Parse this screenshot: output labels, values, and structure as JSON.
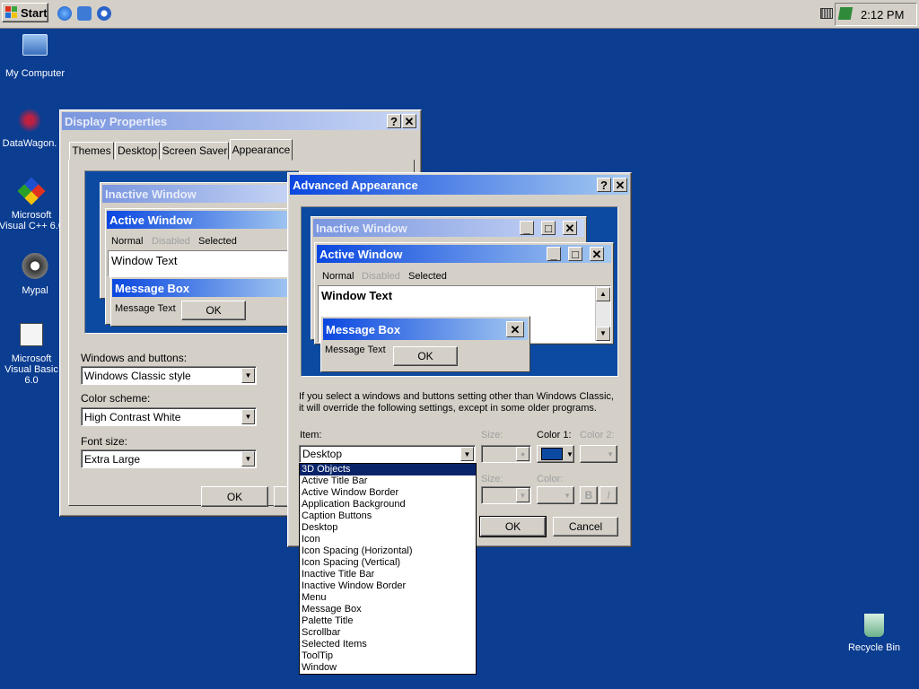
{
  "taskbar": {
    "start_label": "Start",
    "clock": "2:12 PM"
  },
  "desktop_icons": [
    {
      "label": "My Computer"
    },
    {
      "label": "DataWagon."
    },
    {
      "label": "Microsoft Visual C++ 6.0"
    },
    {
      "label": "Mypal"
    },
    {
      "label": "Microsoft Visual Basic 6.0"
    },
    {
      "label": "Recycle Bin"
    }
  ],
  "display_properties": {
    "title": "Display Properties",
    "tabs": [
      "Themes",
      "Desktop",
      "Screen Saver",
      "Appearance"
    ],
    "preview": {
      "inactive_title": "Inactive Window",
      "active_title": "Active Window",
      "menu_normal": "Normal",
      "menu_disabled": "Disabled",
      "menu_selected": "Selected",
      "window_text": "Window Text",
      "msgbox_title": "Message Box",
      "msgbox_text": "Message Text",
      "ok": "OK"
    },
    "windows_buttons_label": "Windows and buttons:",
    "windows_buttons_value": "Windows Classic style",
    "color_scheme_label": "Color scheme:",
    "color_scheme_value": "High Contrast White",
    "font_size_label": "Font size:",
    "font_size_value": "Extra Large",
    "ok": "OK"
  },
  "advanced": {
    "title": "Advanced Appearance",
    "preview": {
      "inactive_title": "Inactive Window",
      "active_title": "Active Window",
      "menu_normal": "Normal",
      "menu_disabled": "Disabled",
      "menu_selected": "Selected",
      "window_text": "Window Text",
      "msgbox_title": "Message Box",
      "msgbox_text": "Message Text",
      "ok": "OK"
    },
    "info_line1": "If you select a windows and buttons setting other than Windows Classic,",
    "info_line2": "it will override the following settings, except in some older programs.",
    "item_label": "Item:",
    "item_value": "Desktop",
    "size_label": "Size:",
    "color1_label": "Color 1:",
    "color2_label": "Color 2:",
    "font_size_label": "Size:",
    "font_color_label": "Color:",
    "bold": "B",
    "italic": "I",
    "ok": "OK",
    "cancel": "Cancel",
    "color1_hex": "#0b4aa0",
    "items": [
      "3D Objects",
      "Active Title Bar",
      "Active Window Border",
      "Application Background",
      "Caption Buttons",
      "Desktop",
      "Icon",
      "Icon Spacing (Horizontal)",
      "Icon Spacing (Vertical)",
      "Inactive Title Bar",
      "Inactive Window Border",
      "Menu",
      "Message Box",
      "Palette Title",
      "Scrollbar",
      "Selected Items",
      "ToolTip",
      "Window"
    ],
    "selected_item": "3D Objects"
  }
}
